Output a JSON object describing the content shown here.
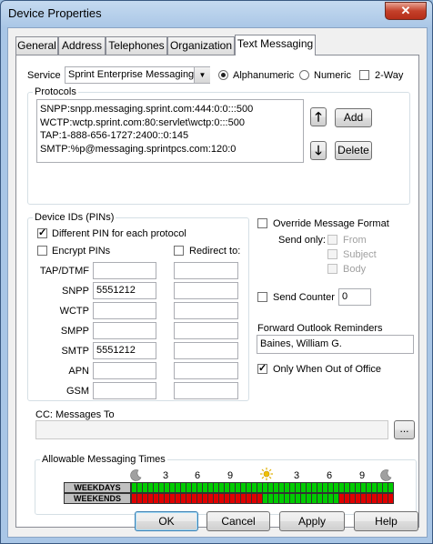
{
  "window": {
    "title": "Device Properties",
    "close_glyph": "✕"
  },
  "tabs": [
    {
      "label": "General"
    },
    {
      "label": "Address"
    },
    {
      "label": "Telephones"
    },
    {
      "label": "Organization"
    },
    {
      "label": "Text Messaging",
      "active": true
    }
  ],
  "service": {
    "label": "Service",
    "value": "Sprint Enterprise Messaging",
    "radio_alpha": "Alphanumeric",
    "radio_numeric": "Numeric",
    "two_way": "2-Way",
    "selected": "Alphanumeric"
  },
  "protocols": {
    "title": "Protocols",
    "items": [
      "SNPP:snpp.messaging.sprint.com:444:0:0:::500",
      "WCTP:wctp.sprint.com:80:servlet\\wctp:0:::500",
      "TAP:1-888-656-1727:2400::0:145",
      "SMTP:%p@messaging.sprintpcs.com:120:0"
    ],
    "up_glyph": "🡑",
    "down_glyph": "🡓",
    "add_label": "Add",
    "delete_label": "Delete"
  },
  "device_ids": {
    "title": "Device IDs (PINs)",
    "different_pin": "Different PIN for each protocol",
    "different_pin_checked": true,
    "encrypt_pins": "Encrypt PINs",
    "redirect_to": "Redirect to:",
    "rows": [
      {
        "label": "TAP/DTMF",
        "pin": ""
      },
      {
        "label": "SNPP",
        "pin": "5551212"
      },
      {
        "label": "WCTP",
        "pin": ""
      },
      {
        "label": "SMPP",
        "pin": ""
      },
      {
        "label": "SMTP",
        "pin": "5551212"
      },
      {
        "label": "APN",
        "pin": ""
      },
      {
        "label": "GSM",
        "pin": ""
      }
    ]
  },
  "override": {
    "label": "Override Message Format",
    "send_only": "Send only:",
    "from": "From",
    "subject": "Subject",
    "body": "Body"
  },
  "send_counter": {
    "label": "Send Counter",
    "value": "0"
  },
  "reminders": {
    "label": "Forward Outlook Reminders",
    "value": "Baines, William G.",
    "only_when_out": "Only When Out of Office",
    "only_when_out_checked": true
  },
  "cc": {
    "label": "CC: Messages To",
    "value": "",
    "browse_label": "..."
  },
  "times": {
    "title": "Allowable Messaging Times",
    "hour_labels": [
      "3",
      "6",
      "9",
      "3",
      "6",
      "9"
    ],
    "weekdays_label": "WEEKDAYS",
    "weekends_label": "WEEKENDS",
    "weekdays": [
      1,
      1,
      1,
      1,
      1,
      1,
      1,
      1,
      1,
      1,
      1,
      1,
      1,
      1,
      1,
      1,
      1,
      1,
      1,
      1,
      1,
      1,
      1,
      1,
      1,
      1,
      1,
      1,
      1,
      1,
      1,
      1,
      1,
      1,
      1,
      1,
      1,
      1,
      1,
      1,
      1,
      1,
      1,
      1,
      1,
      1,
      1,
      1,
      1,
      1,
      1,
      1,
      1,
      1,
      1,
      1,
      1,
      1,
      1,
      1,
      1,
      1,
      1,
      1,
      1,
      1,
      1,
      1,
      1,
      1,
      1,
      1,
      1,
      1,
      1,
      1,
      1,
      1,
      1,
      1,
      1,
      1,
      1,
      1,
      1,
      1,
      1,
      1,
      1,
      1,
      1,
      1,
      1,
      1,
      1,
      1
    ],
    "weekends": [
      0,
      0,
      0,
      0,
      0,
      0,
      0,
      0,
      0,
      0,
      0,
      0,
      0,
      0,
      0,
      0,
      0,
      0,
      0,
      0,
      0,
      0,
      0,
      0,
      0,
      0,
      0,
      0,
      0,
      0,
      0,
      0,
      0,
      0,
      0,
      0,
      0,
      0,
      0,
      0,
      0,
      0,
      0,
      0,
      0,
      0,
      0,
      0,
      1,
      1,
      1,
      1,
      1,
      1,
      1,
      1,
      1,
      1,
      1,
      1,
      1,
      1,
      1,
      1,
      1,
      1,
      1,
      1,
      1,
      1,
      1,
      1,
      1,
      1,
      1,
      1,
      0,
      0,
      0,
      0,
      0,
      0,
      0,
      0,
      0,
      0,
      0,
      0,
      0,
      0,
      0,
      0,
      0,
      0,
      0,
      0
    ],
    "on_color": "#00cc00",
    "off_color": "#e00000",
    "moon_icon": "moon-icon",
    "sun_icon": "sun-icon"
  },
  "footer": {
    "ok": "OK",
    "cancel": "Cancel",
    "apply": "Apply",
    "help": "Help"
  }
}
